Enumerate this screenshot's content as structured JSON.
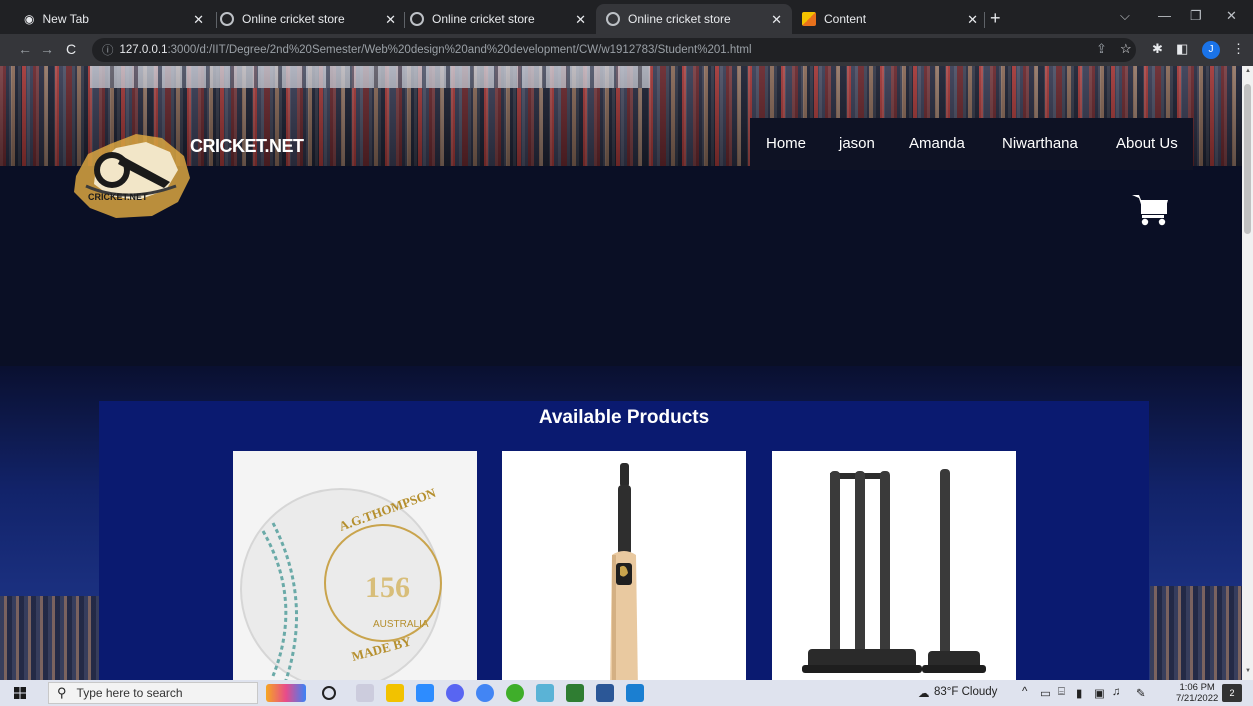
{
  "browser": {
    "tabs": [
      {
        "title": "New Tab",
        "icon": "new-tab-icon",
        "active": false
      },
      {
        "title": "Online cricket store",
        "icon": "globe-icon",
        "active": false
      },
      {
        "title": "Online cricket store",
        "icon": "globe-icon",
        "active": false
      },
      {
        "title": "Online cricket store",
        "icon": "globe-icon",
        "active": true
      },
      {
        "title": "Content",
        "icon": "content-icon",
        "active": false
      }
    ],
    "new_tab_symbol": "+",
    "address": {
      "host": "127.0.0.1",
      "path": ":3000/d:/IIT/Degree/2nd%20Semester/Web%20design%20and%20development/CW/w1912783/Student%201.html"
    },
    "profile_initial": "J"
  },
  "site": {
    "title": "CRICKET.NET",
    "logo_text": "CRICKET.NET",
    "nav": [
      "Home",
      "jason",
      "Amanda",
      "Niwarthana",
      "About Us"
    ],
    "products_heading": "Available Products",
    "products": [
      {
        "name": "cricket-ball",
        "ball_text_top": "A.G.THOMPSON",
        "ball_text_mid": "156",
        "ball_text_bottom": "AUSTRALIA",
        "ball_text_made": "MADE BY"
      },
      {
        "name": "cricket-bat"
      },
      {
        "name": "cricket-stumps"
      }
    ]
  },
  "taskbar": {
    "search_placeholder": "Type here to search",
    "weather": "83°F  Cloudy",
    "time": "1:06 PM",
    "date": "7/21/2022",
    "notification_count": "2"
  },
  "colors": {
    "products_bg": "#0a1a70",
    "navbar_bg": "#0e1224",
    "page_dark": "#0a0f25"
  }
}
